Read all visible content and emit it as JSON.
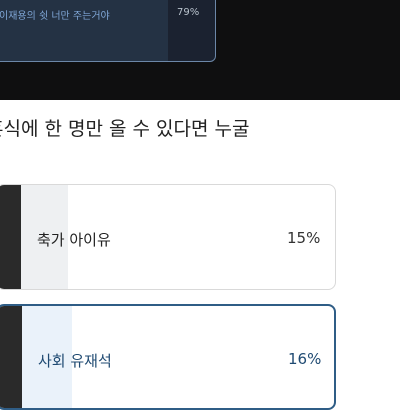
{
  "previous_poll": {
    "option_text": "이재용의 쉿 너만 주는거야",
    "percent_label": "79%",
    "percent": 79
  },
  "question": {
    "line1": "혼식에 한 명만 올 수 있다면 누굴",
    "line2": "?"
  },
  "options": [
    {
      "label": "축가 아이유",
      "percent_label": "15%",
      "percent": 15,
      "selected": false
    },
    {
      "label": "사회 유재석",
      "percent_label": "16%",
      "percent": 16,
      "selected": true
    }
  ]
}
